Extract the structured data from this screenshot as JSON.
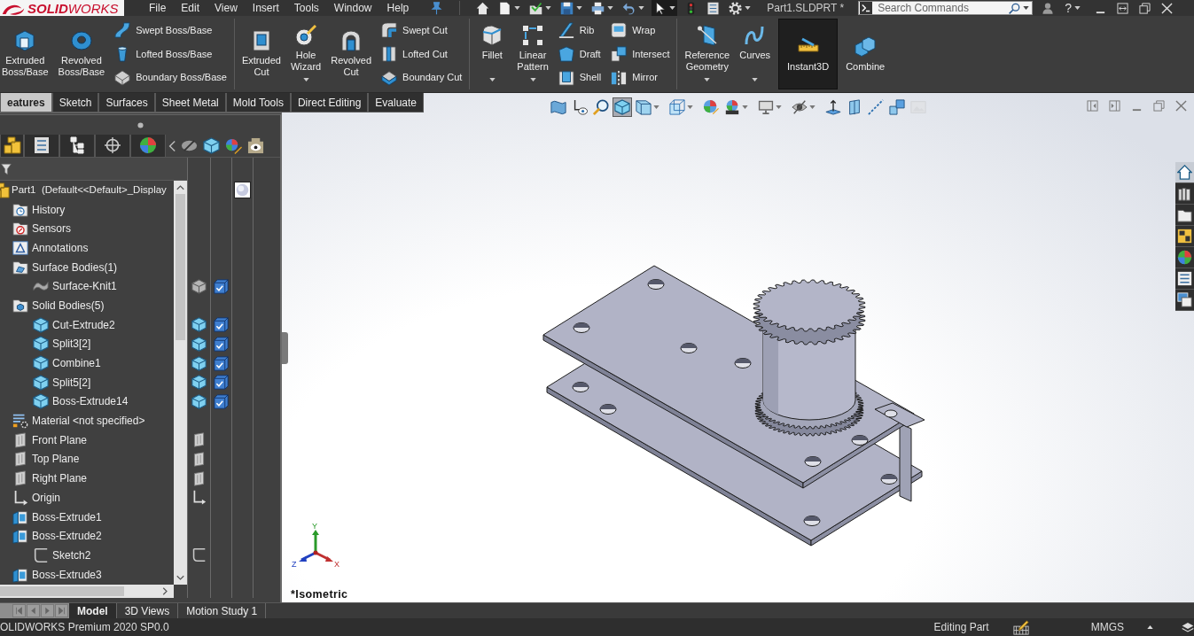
{
  "app": {
    "logo": "**SOLID**WORKS",
    "menu": [
      "File",
      "Edit",
      "View",
      "Insert",
      "Tools",
      "Window",
      "Help"
    ],
    "quick_access": [
      {
        "dropdown": false,
        "on": false
      },
      {
        "dropdown": false,
        "on": false
      },
      {
        "dropdown": true,
        "on": false
      },
      {
        "dropdown": true,
        "on": false
      },
      {
        "dropdown": true,
        "on": false
      },
      {
        "dropdown": true,
        "on": false
      },
      {
        "dropdown": true,
        "on": false
      },
      {
        "dropdown": true,
        "on": true
      },
      {
        "dropdown": false,
        "on": false
      },
      {
        "dropdown": false,
        "on": false
      },
      {
        "dropdown": true,
        "on": false
      }
    ],
    "document": "Part1.SLDPRT *",
    "search": {
      "placeholder": "Search Commands"
    },
    "help": "?"
  },
  "ribbon": [
    {
      "tools": [
        {
          "kind": "large",
          "label": "Extruded\nBoss/Base",
          "dropdown": false,
          "on": false
        },
        {
          "kind": "large",
          "label": "Revolved\nBoss/Base",
          "dropdown": false,
          "on": false
        },
        {
          "kind": "stack",
          "items": [
            "Swept Boss/Base",
            "Lofted Boss/Base",
            "Boundary Boss/Base"
          ]
        }
      ]
    },
    {
      "tools": [
        {
          "kind": "large",
          "label": "Extruded\nCut",
          "dropdown": false,
          "on": false
        },
        {
          "kind": "large",
          "label": "Hole\nWizard",
          "dropdown": true,
          "on": false
        },
        {
          "kind": "large",
          "label": "Revolved\nCut",
          "dropdown": false,
          "on": false
        },
        {
          "kind": "stack",
          "items": [
            "Swept Cut",
            "Lofted Cut",
            "Boundary Cut"
          ]
        }
      ]
    },
    {
      "tools": [
        {
          "kind": "large",
          "label": "Fillet",
          "dropdown": true,
          "on": false
        },
        {
          "kind": "large",
          "label": "Linear\nPattern",
          "dropdown": true,
          "on": false
        },
        {
          "kind": "stack",
          "items": [
            "Rib",
            "Draft",
            "Shell"
          ]
        },
        {
          "kind": "stack",
          "items": [
            "Wrap",
            "Intersect",
            "Mirror"
          ]
        }
      ]
    },
    {
      "tools": [
        {
          "kind": "large",
          "label": "Reference\nGeometry",
          "dropdown": true,
          "on": false
        },
        {
          "kind": "large",
          "label": "Curves",
          "dropdown": true,
          "on": false
        },
        {
          "kind": "large",
          "label": "Instant3D",
          "dropdown": false,
          "on": true
        },
        {
          "kind": "large",
          "label": "Combine",
          "dropdown": false,
          "on": false
        }
      ]
    }
  ],
  "command_tabs": [
    {
      "label": "eatures",
      "selected": true
    },
    {
      "label": "Sketch",
      "selected": false
    },
    {
      "label": "Surfaces",
      "selected": false
    },
    {
      "label": "Sheet Metal",
      "selected": false
    },
    {
      "label": "Mold Tools",
      "selected": false
    },
    {
      "label": "Direct Editing",
      "selected": false
    },
    {
      "label": "Evaluate",
      "selected": false
    }
  ],
  "feature_tree": {
    "label": "Part1  (Default<<Default>_Display",
    "kind": "part",
    "children": [
      {
        "label": "History",
        "kind": "history"
      },
      {
        "label": "Sensors",
        "kind": "sensors"
      },
      {
        "label": "Annotations",
        "kind": "annotations"
      },
      {
        "label": "Surface Bodies(1)",
        "kind": "surface-folder",
        "children": [
          {
            "label": "Surface-Knit1",
            "kind": "surface"
          }
        ]
      },
      {
        "label": "Solid Bodies(5)",
        "kind": "solid-folder",
        "children": [
          {
            "label": "Cut-Extrude2",
            "kind": "solid"
          },
          {
            "label": "Split3[2]",
            "kind": "solid"
          },
          {
            "label": "Combine1",
            "kind": "solid"
          },
          {
            "label": "Split5[2]",
            "kind": "solid"
          },
          {
            "label": "Boss-Extrude14",
            "kind": "solid"
          }
        ]
      },
      {
        "label": "Material <not specified>",
        "kind": "material"
      },
      {
        "label": "Front Plane",
        "kind": "plane"
      },
      {
        "label": "Top Plane",
        "kind": "plane"
      },
      {
        "label": "Right Plane",
        "kind": "plane"
      },
      {
        "label": "Origin",
        "kind": "origin"
      },
      {
        "label": "Boss-Extrude1",
        "kind": "feature"
      },
      {
        "label": "Boss-Extrude2",
        "kind": "feature",
        "children": [
          {
            "label": "Sketch2",
            "kind": "sketch"
          }
        ]
      },
      {
        "label": "Boss-Extrude3",
        "kind": "feature"
      }
    ]
  },
  "graphics": {
    "view_toolbar": [
      {
        "dropdown": false,
        "on": false,
        "disabled": false
      },
      {
        "dropdown": false,
        "on": false,
        "disabled": false
      },
      {
        "dropdown": false,
        "on": false,
        "disabled": false
      },
      {
        "dropdown": false,
        "on": true,
        "disabled": false
      },
      {
        "dropdown": true,
        "on": false,
        "disabled": false
      },
      {
        "dropdown": true,
        "on": false,
        "disabled": false
      },
      {
        "dropdown": false,
        "on": false,
        "disabled": false
      },
      {
        "dropdown": true,
        "on": false,
        "disabled": false
      },
      {
        "dropdown": true,
        "on": false,
        "disabled": false
      },
      {
        "dropdown": true,
        "on": false,
        "disabled": false
      },
      {
        "dropdown": false,
        "on": false,
        "disabled": false
      },
      {
        "dropdown": false,
        "on": false,
        "disabled": false
      },
      {
        "dropdown": false,
        "on": false,
        "disabled": false
      },
      {
        "dropdown": false,
        "on": false,
        "disabled": false
      },
      {
        "dropdown": false,
        "on": false,
        "disabled": true
      }
    ],
    "task_pane": [
      {
        "selected": true
      },
      {
        "selected": false
      },
      {
        "selected": false
      },
      {
        "selected": false
      },
      {
        "selected": false
      },
      {
        "selected": false
      },
      {
        "selected": false
      }
    ],
    "triad": [
      "Y",
      "Z",
      "X"
    ],
    "view_name": "*Isometric"
  },
  "bottom_tabs": [
    {
      "label": "Model",
      "selected": true
    },
    {
      "label": "3D Views",
      "selected": false
    },
    {
      "label": "Motion Study 1",
      "selected": false
    }
  ],
  "status_bar": {
    "product": "OLIDWORKS Premium 2020 SP0.0",
    "mode": "Editing Part",
    "units": "MMGS"
  }
}
